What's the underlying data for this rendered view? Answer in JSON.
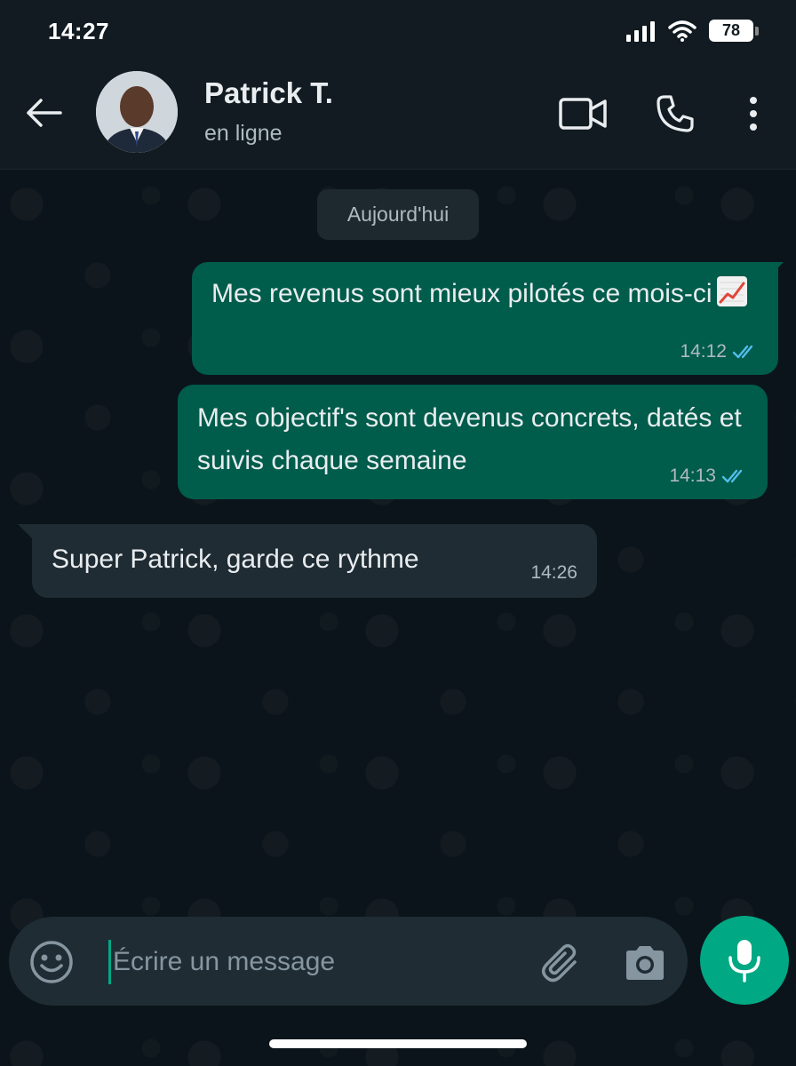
{
  "status_bar": {
    "time": "14:27",
    "battery": "78"
  },
  "header": {
    "contact_name": "Patrick T.",
    "contact_status": "en ligne"
  },
  "chat": {
    "date_separator": "Aujourd'hui",
    "messages": [
      {
        "direction": "outgoing",
        "text": "Mes revenus sont mieux pilotés ce mois-ci",
        "emoji": "chart-increasing-icon",
        "time": "14:12",
        "status": "read"
      },
      {
        "direction": "outgoing",
        "text": "Mes objectif's sont devenus concrets, datés et suivis chaque semaine",
        "time": "14:13",
        "status": "read"
      },
      {
        "direction": "incoming",
        "text": "Super Patrick, garde ce rythme",
        "time": "14:26"
      }
    ]
  },
  "composer": {
    "placeholder": "Écrire un message"
  },
  "colors": {
    "background": "#0b141a",
    "header": "#111b21",
    "outgoing_bubble": "#005c4b",
    "incoming_bubble": "#1f2c34",
    "accent": "#00a884",
    "read_ticks": "#53bdeb"
  }
}
